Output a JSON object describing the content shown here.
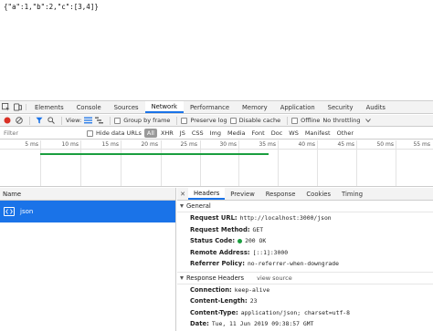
{
  "page": {
    "body_text": "{\"a\":1,\"b\":2,\"c\":[3,4]}"
  },
  "devtools": {
    "tabs": [
      {
        "label": "Elements"
      },
      {
        "label": "Console"
      },
      {
        "label": "Sources"
      },
      {
        "label": "Network"
      },
      {
        "label": "Performance"
      },
      {
        "label": "Memory"
      },
      {
        "label": "Application"
      },
      {
        "label": "Security"
      },
      {
        "label": "Audits"
      }
    ],
    "active_tab": "Network",
    "toolbar": {
      "view_label": "View:",
      "group_by_frame": "Group by frame",
      "preserve_log": "Preserve log",
      "disable_cache": "Disable cache",
      "offline": "Offline",
      "throttling": "No throttling"
    },
    "filter": {
      "placeholder": "Filter",
      "hide_data_urls": "Hide data URLs",
      "types": [
        "All",
        "XHR",
        "JS",
        "CSS",
        "Img",
        "Media",
        "Font",
        "Doc",
        "WS",
        "Manifest",
        "Other"
      ],
      "active_type": "All"
    },
    "timeline": {
      "ticks": [
        "5 ms",
        "10 ms",
        "15 ms",
        "20 ms",
        "25 ms",
        "30 ms",
        "35 ms",
        "40 ms",
        "45 ms",
        "50 ms",
        "55 ms"
      ]
    },
    "requests": {
      "column_name": "Name",
      "rows": [
        {
          "name": "json"
        }
      ]
    },
    "details": {
      "tabs": [
        "Headers",
        "Preview",
        "Response",
        "Cookies",
        "Timing"
      ],
      "active_tab": "Headers",
      "general": {
        "title": "General",
        "request_url_key": "Request URL:",
        "request_url": "http://localhost:3000/json",
        "request_method_key": "Request Method:",
        "request_method": "GET",
        "status_code_key": "Status Code:",
        "status_code": "200 OK",
        "remote_address_key": "Remote Address:",
        "remote_address": "[::1]:3000",
        "referrer_policy_key": "Referrer Policy:",
        "referrer_policy": "no-referrer-when-downgrade"
      },
      "response_headers": {
        "title": "Response Headers",
        "view_source": "view source",
        "connection_key": "Connection:",
        "connection": "keep-alive",
        "content_length_key": "Content-Length:",
        "content_length": "23",
        "content_type_key": "Content-Type:",
        "content_type": "application/json; charset=utf-8",
        "date_key": "Date:",
        "date": "Tue, 11 Jun 2019 09:38:57 GMT"
      }
    },
    "colors": {
      "accent": "#1a73e8",
      "record": "#d93025",
      "status_ok": "#1a9e3f"
    }
  }
}
